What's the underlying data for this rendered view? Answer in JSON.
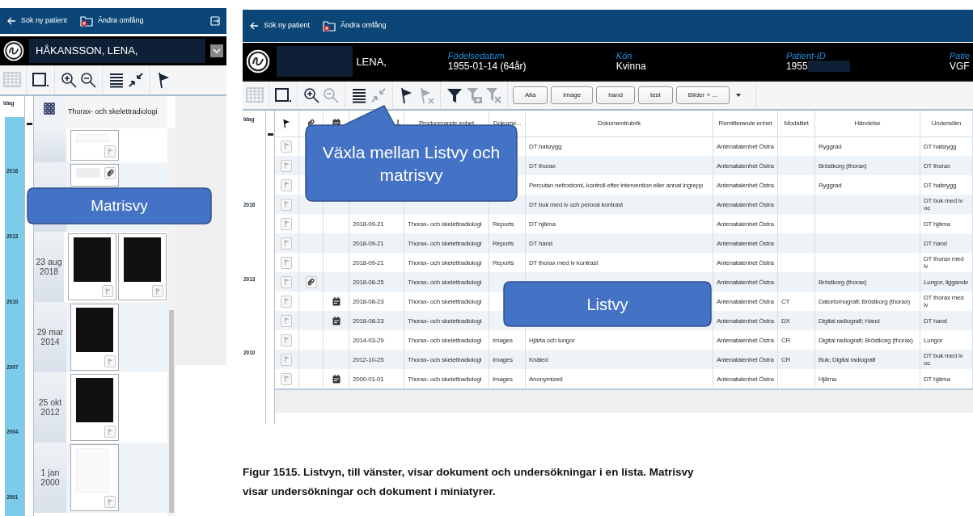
{
  "left_screen": {
    "top_bar": {
      "back_label": "Sök ny patient",
      "scope_label": "Ändra omfång"
    },
    "patient": {
      "name": "HÅKANSSON, LENA,"
    },
    "toolbar": [
      {
        "kind": "calendar-grid",
        "disabled": true
      },
      {
        "kind": "frame",
        "disabled": false
      },
      {
        "kind": "zoom-in",
        "disabled": false
      },
      {
        "kind": "zoom-out",
        "disabled": false
      },
      {
        "kind": "list",
        "disabled": false
      },
      {
        "kind": "collapse",
        "disabled": false
      },
      {
        "kind": "flag",
        "disabled": false
      }
    ],
    "timeline": [
      "Idag",
      "2016",
      "2013",
      "2010",
      "2007",
      "2004",
      "2001"
    ],
    "slider": {
      "level": 0.07
    },
    "matrix": {
      "header": "Thorax- och skelettradiologi",
      "rows": [
        {
          "thumbnails": [
            {
              "kind": "document",
              "flag": true,
              "attachment": false
            }
          ]
        },
        {
          "thumbnails": [
            {
              "kind": "document",
              "flag": false,
              "attachment": true
            }
          ]
        },
        {
          "date": "23 aug 2018",
          "thumbnails": [
            {
              "kind": "image",
              "flag": true,
              "attachment": false
            },
            {
              "kind": "image",
              "flag": true,
              "attachment": false
            }
          ]
        },
        {
          "date": "29 mar 2014",
          "thumbnails": [
            {
              "kind": "image",
              "flag": true,
              "attachment": false
            }
          ]
        },
        {
          "date": "25 okt 2012",
          "thumbnails": [
            {
              "kind": "image",
              "flag": true,
              "attachment": false
            }
          ]
        },
        {
          "date": "1 jan 2000",
          "thumbnails": [
            {
              "kind": "document",
              "flag": true,
              "attachment": false
            }
          ]
        }
      ]
    },
    "callout": "Matrisvy"
  },
  "right_screen": {
    "top_bar": {
      "back_label": "Sök ny patient",
      "scope_label": "Ändra omfång"
    },
    "patient": {
      "name": "LENA,",
      "fields": [
        {
          "label": "Födelsedatum",
          "value": "1955-01-14 (64år)",
          "masked": false
        },
        {
          "label": "Kön",
          "value": "Kvinna",
          "masked": false
        },
        {
          "label": "Patient-ID",
          "value": "1955",
          "masked": true
        },
        {
          "label": "Patie",
          "value": "VGF",
          "masked": false
        }
      ]
    },
    "toolbar": [
      {
        "kind": "calendar-grid",
        "disabled": true
      },
      {
        "kind": "frame",
        "disabled": false
      },
      {
        "kind": "zoom-in",
        "disabled": false
      },
      {
        "kind": "zoom-out",
        "disabled": true
      },
      {
        "kind": "list",
        "disabled": false
      },
      {
        "kind": "collapse",
        "disabled": true
      },
      {
        "kind": "flag",
        "disabled": false
      },
      {
        "kind": "flag-cross",
        "disabled": true
      },
      {
        "kind": "filter",
        "disabled": false
      },
      {
        "kind": "filter-camera",
        "disabled": true
      },
      {
        "kind": "filter-cross",
        "disabled": true
      }
    ],
    "filters": [
      "Alla",
      "image",
      "hand",
      "test",
      "Bilder + ..."
    ],
    "timeline": [
      "Idag",
      "2016",
      "2013",
      "2010"
    ],
    "slider": {
      "level": 0.08
    },
    "icon_columns": [
      {
        "kind": "flag"
      },
      {
        "kind": "attachment"
      },
      {
        "kind": "calendar"
      }
    ],
    "columns": [
      {
        "sorted": true
      },
      {
        "label": "Producerande enhet",
        "sorted": false
      },
      {
        "label": "Dokume...",
        "sorted": false
      },
      {
        "label": "Dokumentrubrik",
        "sorted": false
      },
      {
        "label": "Remitterande enhet",
        "sorted": false
      },
      {
        "label": "Modalitet",
        "sorted": false
      },
      {
        "label": "Händelse",
        "sorted": false
      },
      {
        "label": "Undersökn",
        "sorted": false
      }
    ],
    "rows": [
      {
        "attachment": false,
        "calendar": false,
        "cells": [
          null,
          null,
          null,
          "DT halsrygg",
          "Antenatalenhet Östra",
          null,
          "Ryggrad",
          "DT halsrygg"
        ]
      },
      {
        "attachment": false,
        "calendar": false,
        "cells": [
          null,
          null,
          null,
          "DT thorax",
          "Antenatalenhet Östra",
          null,
          "Bröstkorg (thorax)",
          "DT thorax"
        ]
      },
      {
        "attachment": false,
        "calendar": false,
        "cells": [
          null,
          null,
          null,
          "Percutan nefrostomi, kontroll efter intervention eller annat ingrepp",
          "Antenatalenhet Östra",
          null,
          "Ryggrad",
          "DT halsrygg"
        ]
      },
      {
        "attachment": false,
        "calendar": false,
        "cells": [
          null,
          null,
          null,
          "DT buk med iv och peroral kontrast",
          "Antenatalenhet Östra",
          null,
          null,
          "DT buk med iv oc"
        ]
      },
      {
        "attachment": false,
        "calendar": false,
        "cells": [
          "2018-09-21",
          "Thorax- och skelettradiologi",
          "Reports",
          "DT hjärna",
          "Antenatalenhet Östra",
          null,
          null,
          "DT hjärna"
        ]
      },
      {
        "attachment": false,
        "calendar": false,
        "cells": [
          "2018-09-21",
          "Thorax- och skelettradiologi",
          "Reports",
          "DT hand",
          "Antenatalenhet Östra",
          null,
          null,
          "DT hand"
        ]
      },
      {
        "attachment": false,
        "calendar": false,
        "cells": [
          "2018-09-21",
          "Thorax- och skelettradiologi",
          "Reports",
          "DT thorax med iv kontrast",
          "Antenatalenhet Östra",
          null,
          null,
          "DT thorax med iv"
        ]
      },
      {
        "attachment": true,
        "calendar": false,
        "cells": [
          "2018-08-25",
          "Thorax- och skelettradiologi",
          null,
          null,
          "Antenatalenhet Östra",
          null,
          "Bröstkorg (thorax)",
          "Lungor, liggande"
        ]
      },
      {
        "attachment": false,
        "calendar": true,
        "cells": [
          "2018-08-23",
          "Thorax- och skelettradiologi",
          null,
          null,
          "Antenatalenhet Östra",
          "CT",
          "Datortomografi; Bröstkorg (thorax)",
          "DT thorax med iv"
        ]
      },
      {
        "attachment": false,
        "calendar": true,
        "cells": [
          "2018-08-23",
          "Thorax- och skelettradiologi",
          null,
          null,
          "Antenatalenhet Östra",
          "DX",
          "Digital radiografi; Hand",
          "DT hand"
        ]
      },
      {
        "attachment": false,
        "calendar": false,
        "cells": [
          "2014-03-29",
          "Thorax- och skelettradiologi",
          "Images",
          "Hjärta och lungor",
          "Antenatalenhet Östra",
          "CR",
          "Digital radiografi; Bröstkorg (thorax)",
          "Lungor"
        ]
      },
      {
        "attachment": false,
        "calendar": false,
        "cells": [
          "2012-10-25",
          "Thorax- och skelettradiologi",
          "Images",
          "Knäled",
          "Antenatalenhet Östra",
          "CR",
          "Buk; Digital radiografi",
          "DT buk med iv oc"
        ]
      },
      {
        "attachment": false,
        "calendar": true,
        "cells": [
          "2000-01-01",
          "Thorax- och skelettradiologi",
          "Images",
          "Anonymized",
          "Antenatalenhet Östra",
          null,
          "Hjärna",
          "DT hjärna"
        ]
      }
    ],
    "callouts": [
      "Växla mellan Listvy och matrisvy",
      "Listvy"
    ]
  },
  "caption": {
    "lines": [
      "Figur 1515.  Listvyn, till vänster, visar dokument och undersökningar i en lista. Matrisvy",
      "visar undersökningar och dokument i miniatyrer."
    ]
  }
}
